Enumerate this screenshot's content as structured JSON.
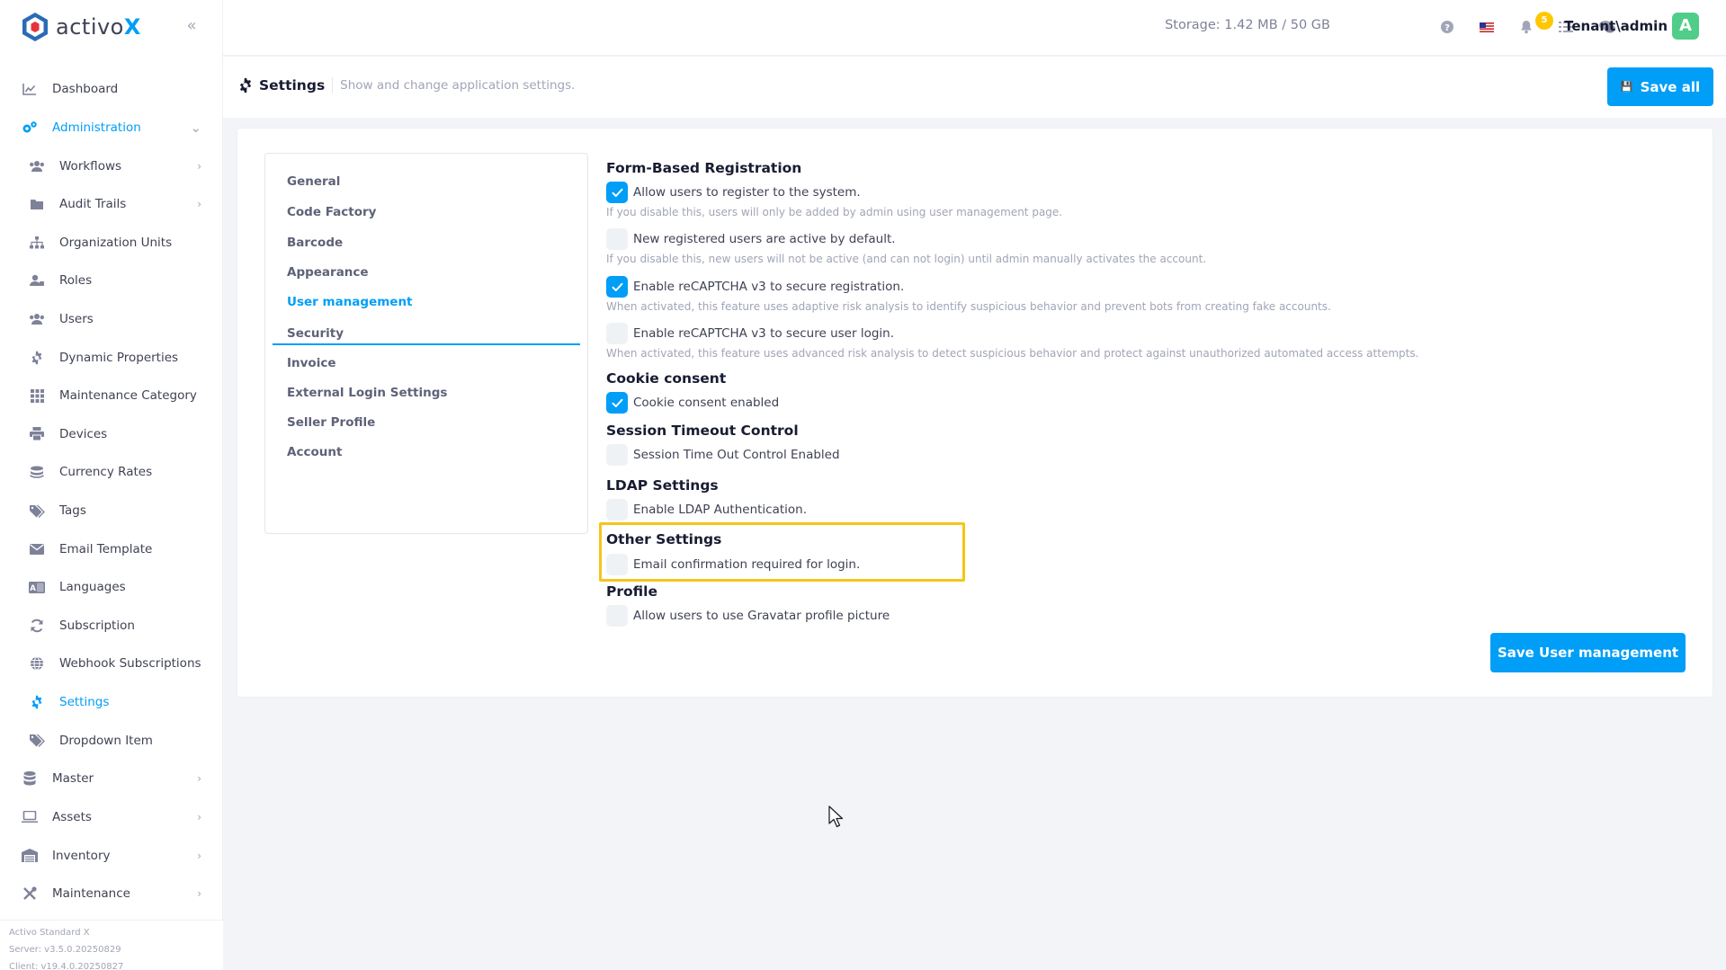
{
  "brand": {
    "name": "activo",
    "x": "X",
    "accent": "#009ef7"
  },
  "sidebar": {
    "items": [
      {
        "label": "Dashboard",
        "icon": "chart-line-icon",
        "level": "top",
        "chevron": false
      },
      {
        "label": "Administration",
        "icon": "cogs-icon",
        "level": "top",
        "chevron": "down",
        "state": "active-parent"
      },
      {
        "label": "Workflows",
        "icon": "users-icon",
        "level": "sub",
        "chevron": "right"
      },
      {
        "label": "Audit Trails",
        "icon": "folder-icon",
        "level": "sub",
        "chevron": "right"
      },
      {
        "label": "Organization Units",
        "icon": "sitemap-icon",
        "level": "sub",
        "chevron": false
      },
      {
        "label": "Roles",
        "icon": "user-tag-icon",
        "level": "sub",
        "chevron": false
      },
      {
        "label": "Users",
        "icon": "users-icon",
        "level": "sub",
        "chevron": false
      },
      {
        "label": "Dynamic Properties",
        "icon": "gear-icon",
        "level": "sub",
        "chevron": false
      },
      {
        "label": "Maintenance Category",
        "icon": "grid-icon",
        "level": "sub",
        "chevron": false
      },
      {
        "label": "Devices",
        "icon": "printer-icon",
        "level": "sub",
        "chevron": false
      },
      {
        "label": "Currency Rates",
        "icon": "coins-icon",
        "level": "sub",
        "chevron": false
      },
      {
        "label": "Tags",
        "icon": "tags-icon",
        "level": "sub",
        "chevron": false
      },
      {
        "label": "Email Template",
        "icon": "envelope-icon",
        "level": "sub",
        "chevron": false
      },
      {
        "label": "Languages",
        "icon": "language-icon",
        "level": "sub",
        "chevron": false
      },
      {
        "label": "Subscription",
        "icon": "sync-icon",
        "level": "sub",
        "chevron": false
      },
      {
        "label": "Webhook Subscriptions",
        "icon": "globe-icon",
        "level": "sub",
        "chevron": false
      },
      {
        "label": "Settings",
        "icon": "gear-icon",
        "level": "sub",
        "chevron": false,
        "state": "active"
      },
      {
        "label": "Dropdown Item",
        "icon": "tags-icon",
        "level": "sub",
        "chevron": false
      },
      {
        "label": "Master",
        "icon": "database-icon",
        "level": "top",
        "chevron": "right"
      },
      {
        "label": "Assets",
        "icon": "laptop-icon",
        "level": "top",
        "chevron": "right"
      },
      {
        "label": "Inventory",
        "icon": "warehouse-icon",
        "level": "top",
        "chevron": "right"
      },
      {
        "label": "Maintenance",
        "icon": "tools-icon",
        "level": "top",
        "chevron": "right"
      }
    ],
    "footer": {
      "product": "Activo Standard X",
      "server": "Server: v3.5.0.20250829",
      "client": "Client: v19.4.0.20250827"
    }
  },
  "header": {
    "storage": "Storage: 1.42 MB / 50 GB",
    "notifications_count": "5",
    "user": "Tenant\\admin",
    "avatar_letter": "A",
    "avatar_color": "#50cd89"
  },
  "toolbar": {
    "title": "Settings",
    "description": "Show and change application settings.",
    "save_all": "Save all"
  },
  "tabs": [
    {
      "label": "General"
    },
    {
      "label": "Code Factory"
    },
    {
      "label": "Barcode"
    },
    {
      "label": "Appearance"
    },
    {
      "label": "User management",
      "active": true
    },
    {
      "label": "Security"
    },
    {
      "label": "Invoice"
    },
    {
      "label": "External Login Settings"
    },
    {
      "label": "Seller Profile"
    },
    {
      "label": "Account"
    }
  ],
  "user_management": {
    "form_registration": {
      "title": "Form-Based Registration",
      "allow_register": {
        "label": "Allow users to register to the system.",
        "checked": true,
        "help": "If you disable this, users will only be added by admin using user management page."
      },
      "active_default": {
        "label": "New registered users are active by default.",
        "checked": false,
        "help": "If you disable this, new users will not be active (and can not login) until admin manually activates the account."
      },
      "recaptcha_registration": {
        "label": "Enable reCAPTCHA v3 to secure registration.",
        "checked": true,
        "help": "When activated, this feature uses adaptive risk analysis to identify suspicious behavior and prevent bots from creating fake accounts."
      },
      "recaptcha_login": {
        "label": "Enable reCAPTCHA v3 to secure user login.",
        "checked": false,
        "help": "When activated, this feature uses advanced risk analysis to detect suspicious behavior and protect against unauthorized automated access attempts."
      }
    },
    "cookie": {
      "title": "Cookie consent",
      "enabled": {
        "label": "Cookie consent enabled",
        "checked": true
      }
    },
    "session": {
      "title": "Session Timeout Control",
      "enabled": {
        "label": "Session Time Out Control Enabled",
        "checked": false
      }
    },
    "ldap": {
      "title": "LDAP Settings",
      "enabled": {
        "label": "Enable LDAP Authentication.",
        "checked": false
      }
    },
    "other": {
      "title": "Other Settings",
      "email_confirm": {
        "label": "Email confirmation required for login.",
        "checked": false
      }
    },
    "profile": {
      "title": "Profile",
      "gravatar": {
        "label": "Allow users to use Gravatar profile picture",
        "checked": false
      }
    },
    "save_button": "Save User management"
  },
  "highlight_color": "#f5c518"
}
